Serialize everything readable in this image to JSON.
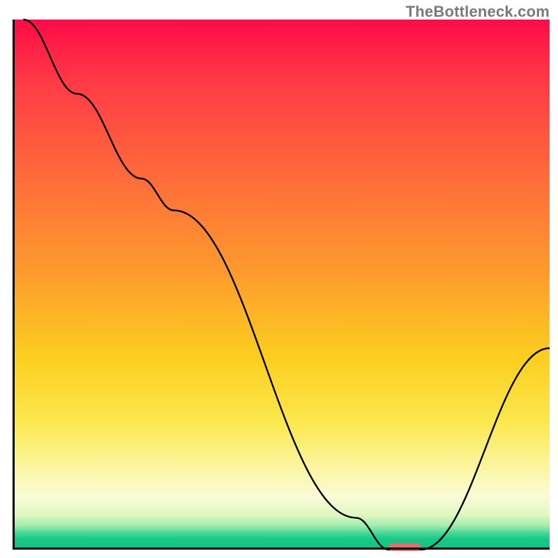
{
  "watermark": "TheBottleneck.com",
  "colors": {
    "curve": "#000000",
    "marker": "#e86b6e",
    "axis": "#000000"
  },
  "chart_data": {
    "type": "line",
    "title": "",
    "xlabel": "",
    "ylabel": "",
    "xlim": [
      0,
      100
    ],
    "ylim": [
      0,
      100
    ],
    "curve": {
      "name": "bottleneck-curve",
      "x": [
        2,
        12,
        24,
        30,
        64,
        70,
        76,
        100
      ],
      "y": [
        100,
        86,
        70,
        64,
        6,
        0,
        0,
        38
      ]
    },
    "optimal_marker": {
      "x_start": 70,
      "x_end": 76,
      "y": 0
    },
    "gradient_background": {
      "top": "#ff0b47",
      "mid_upper": "#fe6c3a",
      "mid": "#fccf1f",
      "lower": "#fbfbd7",
      "bottom": "#12c381"
    }
  }
}
